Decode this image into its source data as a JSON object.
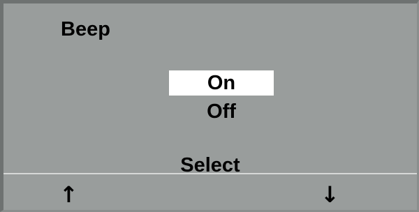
{
  "screen": {
    "title": "Beep"
  },
  "menu": {
    "options": [
      {
        "label": "On",
        "selected": true
      },
      {
        "label": "Off",
        "selected": false
      }
    ]
  },
  "softkeys": {
    "center_label": "Select",
    "up_icon": "↑",
    "down_icon": "↓",
    "up_icon_name": "arrow-up-icon",
    "down_icon_name": "arrow-down-icon"
  },
  "colors": {
    "background": "#999d9c",
    "highlight": "#ffffff",
    "text": "#000000"
  }
}
